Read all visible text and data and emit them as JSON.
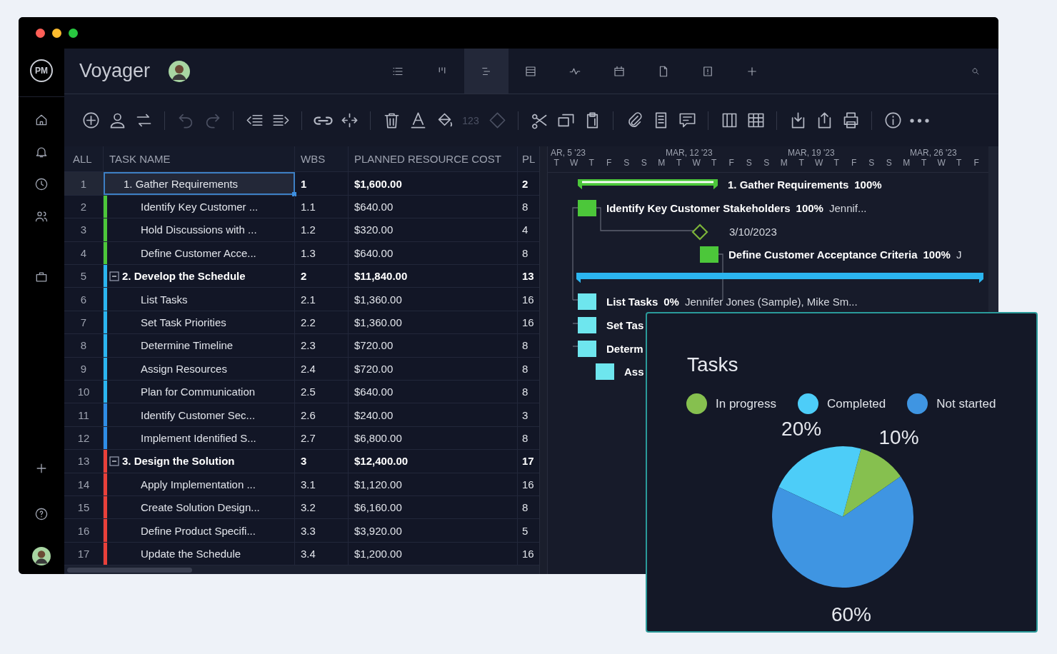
{
  "sidebar": {
    "logo": "PM",
    "items": [
      {
        "kind": "home"
      },
      {
        "kind": "bell"
      },
      {
        "kind": "clock"
      },
      {
        "kind": "people"
      },
      {
        "kind": "briefcase"
      }
    ],
    "bottom": [
      {
        "kind": "plus"
      },
      {
        "kind": "help"
      }
    ]
  },
  "header": {
    "title": "Voyager",
    "views": [
      {
        "kind": "list",
        "selected": false
      },
      {
        "kind": "board",
        "selected": false
      },
      {
        "kind": "gantt",
        "selected": true
      },
      {
        "kind": "sheet",
        "selected": false
      },
      {
        "kind": "pulse",
        "selected": false
      },
      {
        "kind": "calendar",
        "selected": false
      },
      {
        "kind": "file",
        "selected": false
      },
      {
        "kind": "panel",
        "selected": false
      },
      {
        "kind": "plus",
        "selected": false
      }
    ]
  },
  "toolbar": {
    "groups": [
      [
        {
          "kind": "add",
          "disabled": false
        },
        {
          "kind": "user",
          "disabled": false
        },
        {
          "kind": "swap",
          "disabled": false
        }
      ],
      [
        {
          "kind": "undo",
          "disabled": true
        },
        {
          "kind": "redo",
          "disabled": true
        }
      ],
      [
        {
          "kind": "outdent",
          "disabled": false
        },
        {
          "kind": "indent",
          "disabled": false
        }
      ],
      [
        {
          "kind": "link",
          "disabled": false
        },
        {
          "kind": "unlink",
          "disabled": false
        }
      ],
      [
        {
          "kind": "trash",
          "disabled": false
        },
        {
          "kind": "textcolor",
          "disabled": false
        },
        {
          "kind": "paint",
          "disabled": false
        },
        {
          "kind": "number",
          "label": "123",
          "disabled": true
        },
        {
          "kind": "diamond",
          "disabled": true
        }
      ],
      [
        {
          "kind": "cut",
          "disabled": false
        },
        {
          "kind": "copy",
          "disabled": false
        },
        {
          "kind": "paste",
          "disabled": false
        }
      ],
      [
        {
          "kind": "attach",
          "disabled": false
        },
        {
          "kind": "document",
          "disabled": false
        },
        {
          "kind": "comment",
          "disabled": false
        }
      ],
      [
        {
          "kind": "columns",
          "disabled": false
        },
        {
          "kind": "grid",
          "disabled": false
        }
      ],
      [
        {
          "kind": "import",
          "disabled": false
        },
        {
          "kind": "export",
          "disabled": false
        },
        {
          "kind": "print",
          "disabled": false
        }
      ],
      [
        {
          "kind": "info",
          "disabled": false
        },
        {
          "kind": "more",
          "disabled": false
        }
      ]
    ]
  },
  "table": {
    "columns": [
      "ALL",
      "TASK NAME",
      "WBS",
      "PLANNED RESOURCE COST",
      "PL"
    ],
    "rows": [
      {
        "num": "1",
        "name": "1. Gather Requirements",
        "wbs": "1",
        "cost": "$1,600.00",
        "pl": "2",
        "kind": "summary",
        "selected": true
      },
      {
        "num": "2",
        "name": "Identify Key Customer ...",
        "wbs": "1.1",
        "cost": "$640.00",
        "pl": "8",
        "kind": "task",
        "color": "#4cc73a",
        "selected": false
      },
      {
        "num": "3",
        "name": "Hold Discussions with ...",
        "wbs": "1.2",
        "cost": "$320.00",
        "pl": "4",
        "kind": "task",
        "color": "#4cc73a",
        "selected": false
      },
      {
        "num": "4",
        "name": "Define Customer Acce...",
        "wbs": "1.3",
        "cost": "$640.00",
        "pl": "8",
        "kind": "task",
        "color": "#4cc73a",
        "selected": false
      },
      {
        "num": "5",
        "name": "2. Develop the Schedule",
        "wbs": "2",
        "cost": "$11,840.00",
        "pl": "13",
        "kind": "summary",
        "expanded": true,
        "color": "#2bb5ef",
        "selected": false
      },
      {
        "num": "6",
        "name": "List Tasks",
        "wbs": "2.1",
        "cost": "$1,360.00",
        "pl": "16",
        "kind": "task",
        "color": "#2bb5ef",
        "selected": false
      },
      {
        "num": "7",
        "name": "Set Task Priorities",
        "wbs": "2.2",
        "cost": "$1,360.00",
        "pl": "16",
        "kind": "task",
        "color": "#2bb5ef",
        "selected": false
      },
      {
        "num": "8",
        "name": "Determine Timeline",
        "wbs": "2.3",
        "cost": "$720.00",
        "pl": "8",
        "kind": "task",
        "color": "#2bb5ef",
        "selected": false
      },
      {
        "num": "9",
        "name": "Assign Resources",
        "wbs": "2.4",
        "cost": "$720.00",
        "pl": "8",
        "kind": "task",
        "color": "#2bb5ef",
        "selected": false
      },
      {
        "num": "10",
        "name": "Plan for Communication",
        "wbs": "2.5",
        "cost": "$640.00",
        "pl": "8",
        "kind": "task",
        "color": "#2bb5ef",
        "selected": false
      },
      {
        "num": "11",
        "name": "Identify Customer Sec...",
        "wbs": "2.6",
        "cost": "$240.00",
        "pl": "3",
        "kind": "task",
        "color": "#2e8de6",
        "selected": false
      },
      {
        "num": "12",
        "name": "Implement Identified S...",
        "wbs": "2.7",
        "cost": "$6,800.00",
        "pl": "8",
        "kind": "task",
        "color": "#2e8de6",
        "selected": false
      },
      {
        "num": "13",
        "name": "3. Design the Solution",
        "wbs": "3",
        "cost": "$12,400.00",
        "pl": "17",
        "kind": "summary",
        "expanded": true,
        "color": "#e8403a",
        "selected": false
      },
      {
        "num": "14",
        "name": "Apply Implementation ...",
        "wbs": "3.1",
        "cost": "$1,120.00",
        "pl": "16",
        "kind": "task",
        "color": "#e8403a",
        "selected": false
      },
      {
        "num": "15",
        "name": "Create Solution Design...",
        "wbs": "3.2",
        "cost": "$6,160.00",
        "pl": "8",
        "kind": "task",
        "color": "#e8403a",
        "selected": false
      },
      {
        "num": "16",
        "name": "Define Product Specifi...",
        "wbs": "3.3",
        "cost": "$3,920.00",
        "pl": "5",
        "kind": "task",
        "color": "#e8403a",
        "selected": false
      },
      {
        "num": "17",
        "name": "Update the Schedule",
        "wbs": "3.4",
        "cost": "$1,200.00",
        "pl": "16",
        "kind": "task",
        "color": "#e8403a",
        "selected": false
      }
    ]
  },
  "gantt": {
    "weeks": [
      "AR, 5 '23",
      "MAR, 12 '23",
      "MAR, 19 '23",
      "MAR, 26 '23"
    ],
    "days": [
      "T",
      "W",
      "T",
      "F",
      "S",
      "S",
      "M",
      "T",
      "W",
      "T",
      "F",
      "S",
      "S",
      "M",
      "T",
      "W",
      "T",
      "F",
      "S",
      "S",
      "M",
      "T",
      "W",
      "T",
      "F"
    ],
    "items": [
      {
        "kind": "summary",
        "name": "1. Gather Requirements",
        "percent": "100%",
        "color": "#4cc73a"
      },
      {
        "kind": "task",
        "name": "Identify Key Customer Stakeholders",
        "percent": "100%",
        "assignees": "Jennif...",
        "color": "#4cc73a"
      },
      {
        "kind": "milestone",
        "date": "3/10/2023",
        "color": "#7cb33a"
      },
      {
        "kind": "task",
        "name": "Define Customer Acceptance Criteria",
        "percent": "100%",
        "assignees": "J",
        "color": "#4cc73a"
      },
      {
        "kind": "summary",
        "color": "#2bb5ef"
      },
      {
        "kind": "task",
        "name": "List Tasks",
        "percent": "0%",
        "assignees": "Jennifer Jones (Sample), Mike Sm...",
        "color": "#6ee6ee"
      },
      {
        "kind": "task",
        "name": "Set Tas",
        "color": "#6ee6ee"
      },
      {
        "kind": "task",
        "name": "Determ",
        "color": "#6ee6ee"
      },
      {
        "kind": "task",
        "name": "Ass",
        "color": "#6ee6ee"
      }
    ]
  },
  "popup": {
    "legend": [
      {
        "color": "#86c04f"
      },
      {
        "color": "#4dcdf8"
      },
      {
        "color": "#3f95e2"
      }
    ],
    "chart_data": {
      "type": "pie",
      "title": "Tasks",
      "categories": [
        "In progress",
        "Completed",
        "Not started"
      ],
      "values": [
        10,
        20,
        60
      ],
      "value_labels": [
        "10%",
        "20%",
        "60%"
      ]
    }
  }
}
